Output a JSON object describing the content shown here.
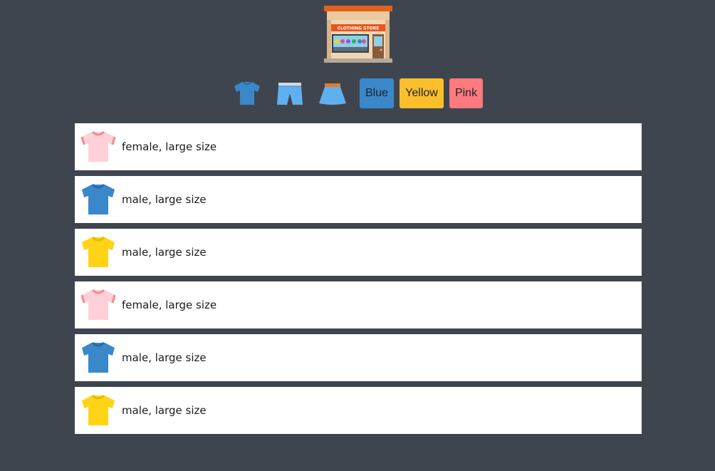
{
  "store": {
    "sign": "CLOTHING STORE"
  },
  "filters": {
    "icons": [
      "tshirt-icon",
      "shorts-icon",
      "skirt-icon"
    ],
    "colors": [
      {
        "label": "Blue",
        "color": "#3a87c9"
      },
      {
        "label": "Yellow",
        "color": "#fbbf2c"
      },
      {
        "label": "Pink",
        "color": "#fd7a7e"
      }
    ]
  },
  "items": [
    {
      "color": "pink",
      "text": "female, large size"
    },
    {
      "color": "blue",
      "text": "male, large size"
    },
    {
      "color": "yellow",
      "text": "male, large size"
    },
    {
      "color": "pink",
      "text": "female, large size"
    },
    {
      "color": "blue",
      "text": "male, large size"
    },
    {
      "color": "yellow",
      "text": "male, large size"
    }
  ],
  "palette": {
    "background": "#3f454e",
    "pink_shirt": "#ffd0d8",
    "pink_trim": "#f48a8a",
    "blue_shirt": "#3a87c9",
    "yellow_shirt": "#ffd417"
  }
}
